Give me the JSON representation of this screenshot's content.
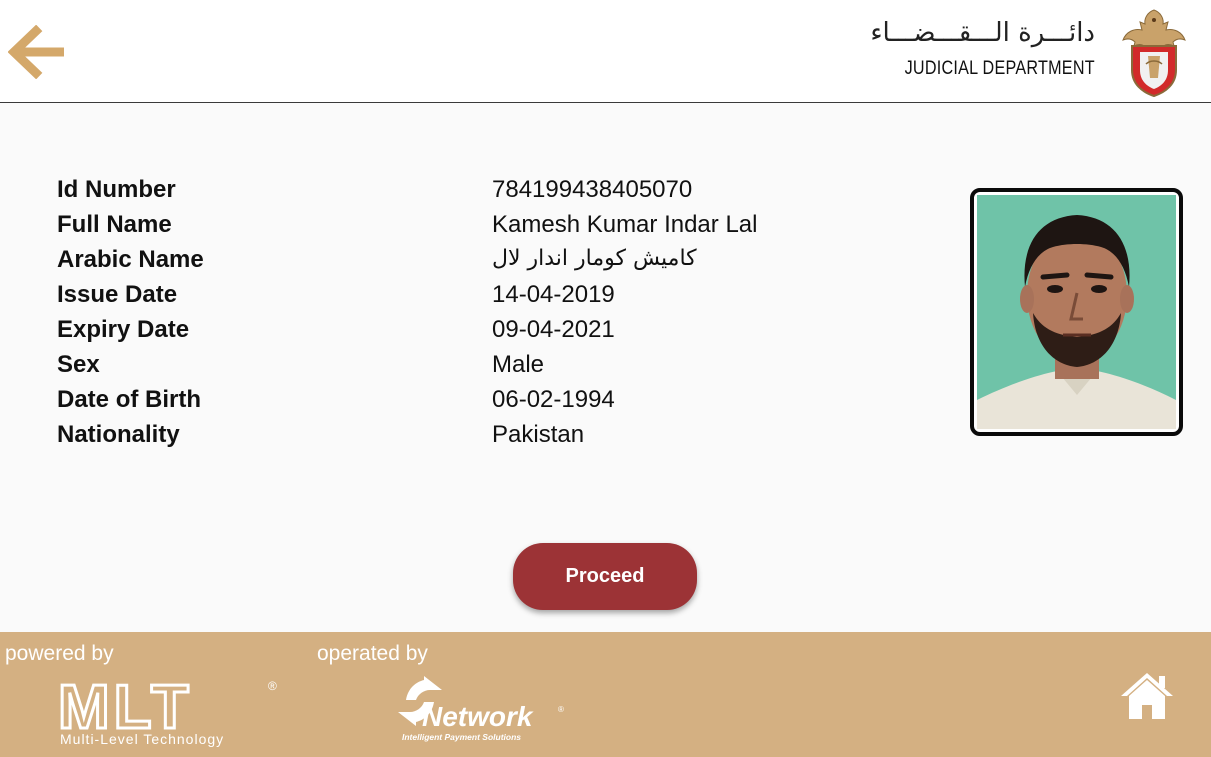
{
  "header": {
    "department_arabic": "دائـــرة الـــقـــضـــاء",
    "department_english": "JUDICIAL DEPARTMENT"
  },
  "details": [
    {
      "label": "Id Number",
      "value": "784199438405070"
    },
    {
      "label": "Full Name",
      "value": "Kamesh Kumar Indar  Lal"
    },
    {
      "label": "Arabic Name",
      "value": "كاميش كومار اندار  لال"
    },
    {
      "label": "Issue Date",
      "value": "14-04-2019"
    },
    {
      "label": "Expiry Date",
      "value": "09-04-2021"
    },
    {
      "label": "Sex",
      "value": "Male"
    },
    {
      "label": "Date of Birth",
      "value": "06-02-1994"
    },
    {
      "label": "Nationality",
      "value": "Pakistan"
    }
  ],
  "actions": {
    "proceed_label": "Proceed"
  },
  "footer": {
    "powered_by": "powered by",
    "operated_by": "operated by",
    "mlt_logo_text": "MLT",
    "mlt_tagline": "Multi-Level Technology",
    "network_logo_text": "Network",
    "network_tagline": "Intelligent Payment Solutions"
  },
  "colors": {
    "accent_red": "#9c3336",
    "footer_tan": "#d4b082",
    "back_arrow": "#d4a86a"
  },
  "icons": {
    "back": "arrow-left-icon",
    "home": "home-icon",
    "emblem": "abu-dhabi-emblem-icon"
  }
}
